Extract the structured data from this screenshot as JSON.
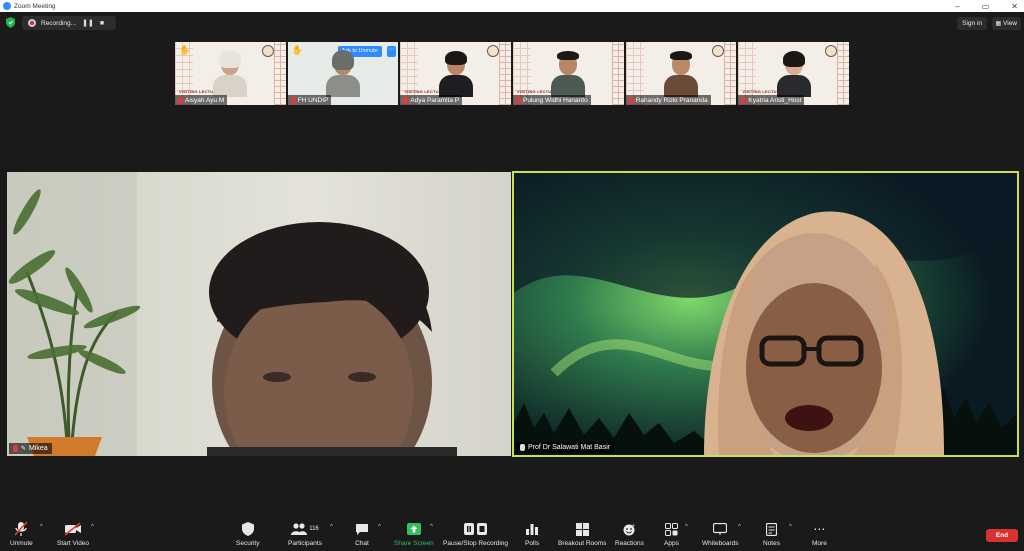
{
  "window": {
    "title": "Zoom Meeting"
  },
  "topbar": {
    "recording_label": "Recording...",
    "pause_symbol": "❚❚",
    "stop_symbol": "■",
    "sign_in_label": "Sign in",
    "view_label": "View"
  },
  "thumbnails": [
    {
      "name": "Aisyah Ayu M",
      "hand_raised": true
    },
    {
      "name": "FH UNDIP",
      "hand_raised": true,
      "ask_to_unmute": "Ask to Unmute"
    },
    {
      "name": "Adya Paramita P",
      "hand_raised": false
    },
    {
      "name": "Pulung Widhi Hananto",
      "hand_raised": false
    },
    {
      "name": "Rahandy Rizki Prananda",
      "hand_raised": false
    },
    {
      "name": "Kyatria Aristi_Host",
      "hand_raised": false
    }
  ],
  "thumbnail_banner": "VISITING LECTURER",
  "main_videos": {
    "left_name": "Mikea",
    "right_name": "Prof Dr Salawati Mat Basir",
    "active_speaker_color": "#c8e04a"
  },
  "toolbar": {
    "unmute": "Unmute",
    "start_video": "Start Video",
    "security": "Security",
    "participants": "Participants",
    "participants_count": "116",
    "chat": "Chat",
    "share_screen": "Share Screen",
    "pause_stop_recording": "Pause/Stop Recording",
    "polls": "Polls",
    "breakout_rooms": "Breakout Rooms",
    "reactions": "Reactions",
    "apps": "Apps",
    "whiteboards": "Whiteboards",
    "notes": "Notes",
    "more": "More",
    "end": "End"
  },
  "colors": {
    "accent": "#2d8cff",
    "share_green": "#30c05f",
    "end_red": "#d93030"
  }
}
